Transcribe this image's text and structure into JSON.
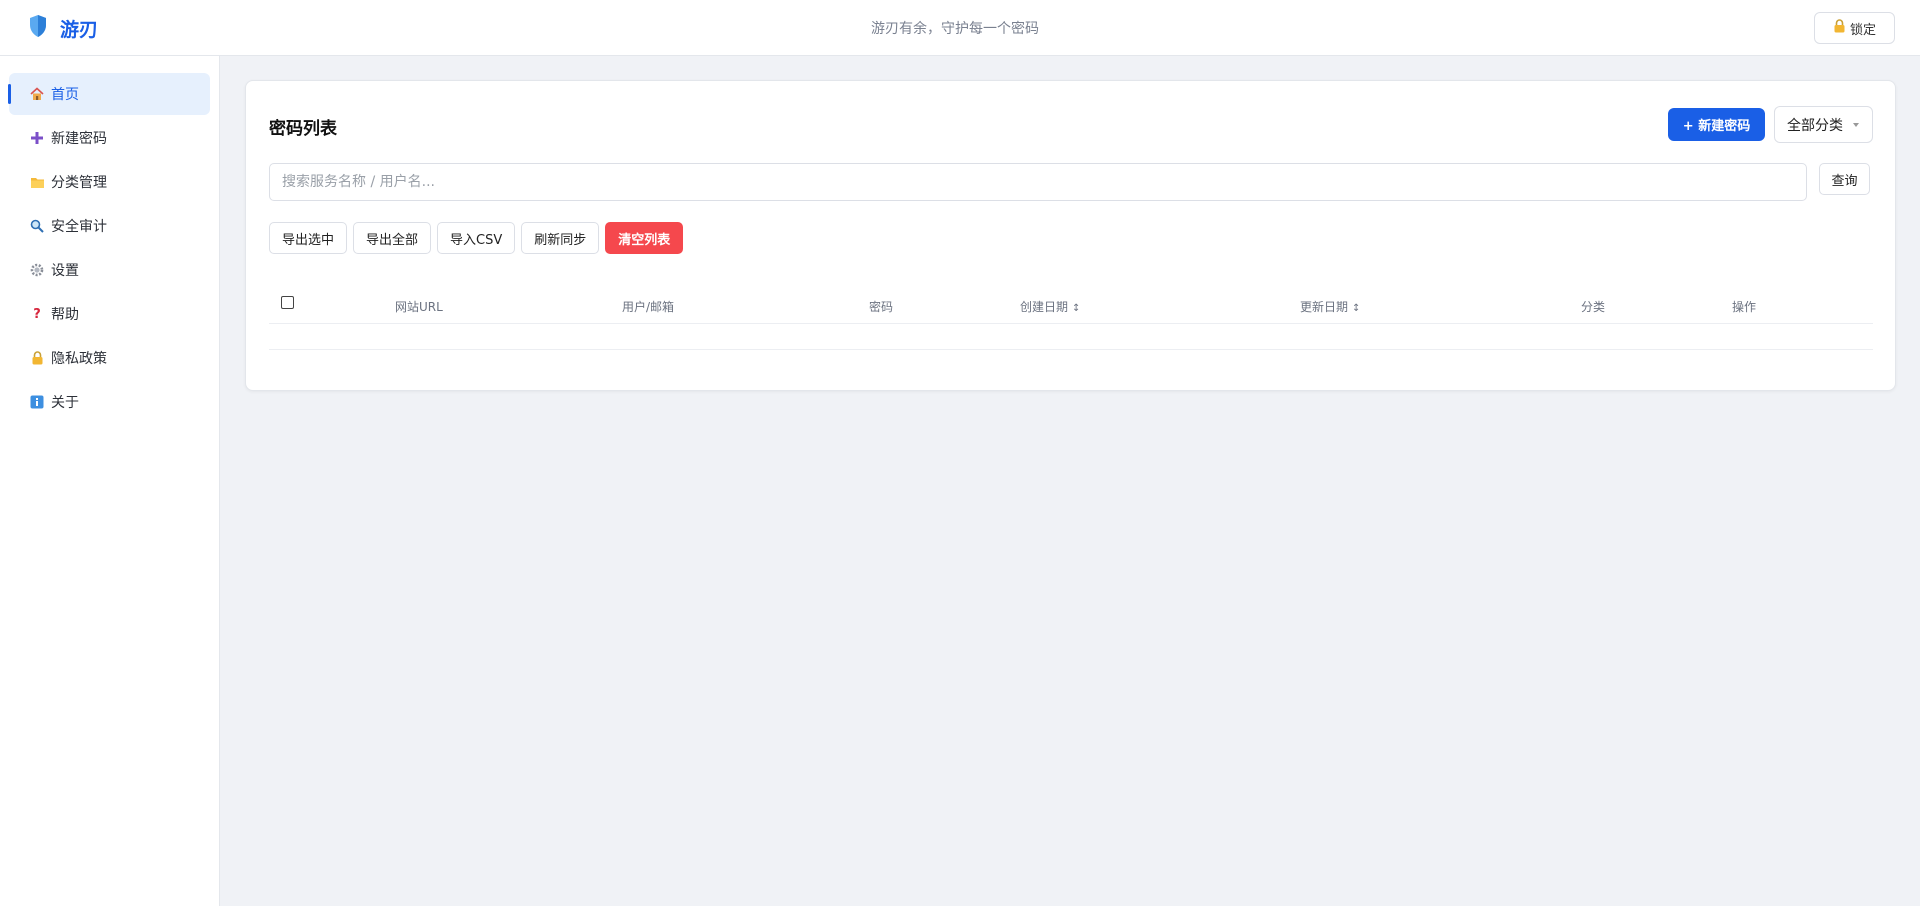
{
  "app": {
    "name": "游刃",
    "slogan": "游刃有余，守护每一个密码",
    "lock_label": "锁定",
    "accent_color": "#1a5fe6",
    "danger_color": "#f5484d"
  },
  "sidebar": {
    "items": [
      {
        "icon": "home-icon",
        "label": "首页",
        "active": true
      },
      {
        "icon": "plus-icon",
        "label": "新建密码"
      },
      {
        "icon": "folder-icon",
        "label": "分类管理"
      },
      {
        "icon": "magnifier-icon",
        "label": "安全审计"
      },
      {
        "icon": "gear-icon",
        "label": "设置"
      },
      {
        "icon": "question-icon",
        "label": "帮助"
      },
      {
        "icon": "lock-icon",
        "label": "隐私政策"
      },
      {
        "icon": "info-icon",
        "label": "关于"
      }
    ]
  },
  "main": {
    "title": "密码列表",
    "new_button": "+ 新建密码",
    "category_select": "全部分类",
    "search": {
      "placeholder": "搜索服务名称 / 用户名...",
      "value": ""
    },
    "query_button": "查询",
    "actions": [
      "导出选中",
      "导出全部",
      "导入CSV",
      "刷新同步",
      "清空列表"
    ],
    "table": {
      "columns": [
        {
          "label": "网站URL"
        },
        {
          "label": "用户/邮箱"
        },
        {
          "label": "密码"
        },
        {
          "label": "创建日期",
          "sortable": true
        },
        {
          "label": "更新日期",
          "sortable": true
        },
        {
          "label": "分类"
        },
        {
          "label": "操作"
        }
      ],
      "rows": []
    }
  }
}
